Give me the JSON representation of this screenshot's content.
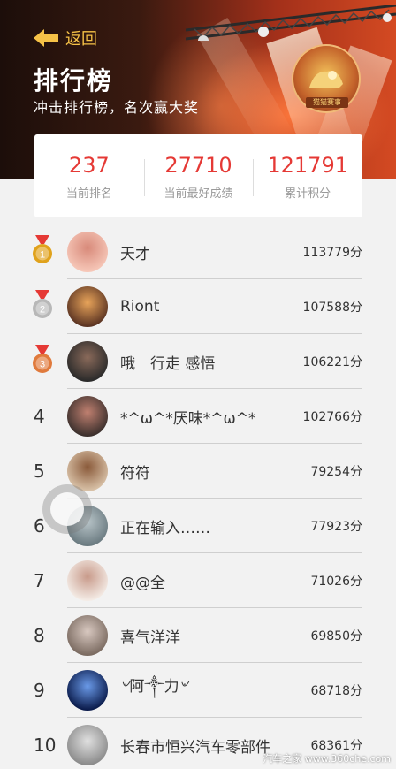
{
  "header": {
    "back_label": "返回",
    "title": "排行榜",
    "subtitle": "冲击排行榜，名次赢大奖",
    "badge_text": "猫猫赛事"
  },
  "stats": [
    {
      "value": "237",
      "label": "当前排名"
    },
    {
      "value": "27710",
      "label": "当前最好成绩"
    },
    {
      "value": "121791",
      "label": "累计积分"
    }
  ],
  "leaderboard": [
    {
      "rank": "1",
      "medal": "gold",
      "name": "天才",
      "score": "113779分"
    },
    {
      "rank": "2",
      "medal": "silver",
      "name": "Riont",
      "score": "107588分"
    },
    {
      "rank": "3",
      "medal": "bronze",
      "name": "哦　行走 感悟",
      "score": "106221分"
    },
    {
      "rank": "4",
      "medal": "",
      "name": "*^ω^*厌味*^ω^*",
      "score": "102766分"
    },
    {
      "rank": "5",
      "medal": "",
      "name": "符符",
      "score": "79254分"
    },
    {
      "rank": "6",
      "medal": "",
      "name": "正在输入……",
      "score": "77923分"
    },
    {
      "rank": "7",
      "medal": "",
      "name": "@@全",
      "score": "71026分"
    },
    {
      "rank": "8",
      "medal": "",
      "name": "喜气洋洋",
      "score": "69850分"
    },
    {
      "rank": "9",
      "medal": "",
      "name": "৺阿༒力৺",
      "score": "68718分"
    },
    {
      "rank": "10",
      "medal": "",
      "name": "长春市恒兴汽车零部件",
      "score": "68361分"
    }
  ],
  "watermark": "汽车之家 www.360che.com",
  "colors": {
    "accent": "#e53935",
    "back": "#f6c247",
    "gold": "#e0a21c",
    "silver": "#b8b8b8",
    "bronze": "#e07a3c"
  },
  "icons": {
    "back": "arrow-left-icon",
    "medal": "medal-icon",
    "float": "floating-assist-icon"
  }
}
